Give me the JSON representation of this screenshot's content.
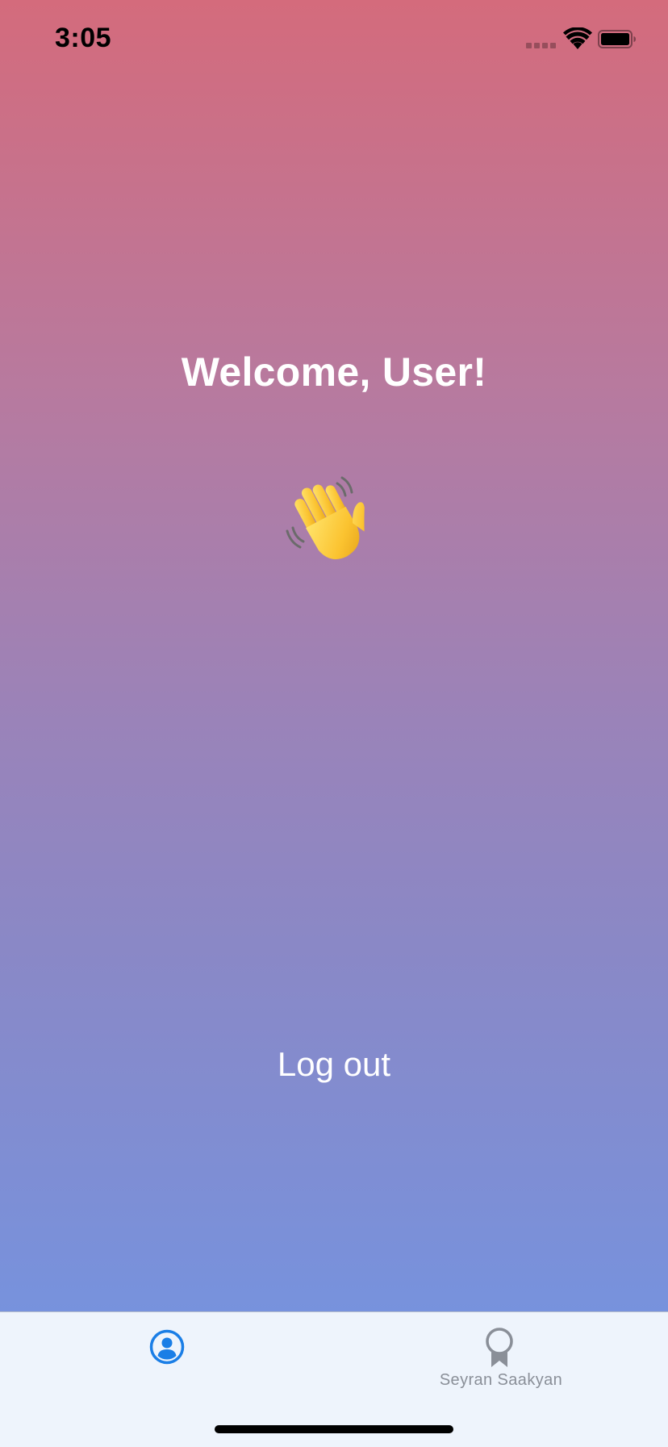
{
  "status_bar": {
    "time": "3:05"
  },
  "main": {
    "welcome_title": "Welcome, User!",
    "emoji": "waving-hand-emoji",
    "logout_label": "Log out"
  },
  "tab_bar": {
    "tabs": [
      {
        "icon": "person-circle-icon",
        "label": "",
        "selected": true
      },
      {
        "icon": "award-ribbon-icon",
        "label": "Seyran Saakyan",
        "selected": false
      }
    ]
  },
  "colors": {
    "gradient_top": "#d46b7c",
    "gradient_bottom": "#7792dd",
    "tab_selected": "#1a7ee6",
    "tab_unselected": "#8a8f98",
    "tab_bar_bg": "#eef4fc"
  }
}
